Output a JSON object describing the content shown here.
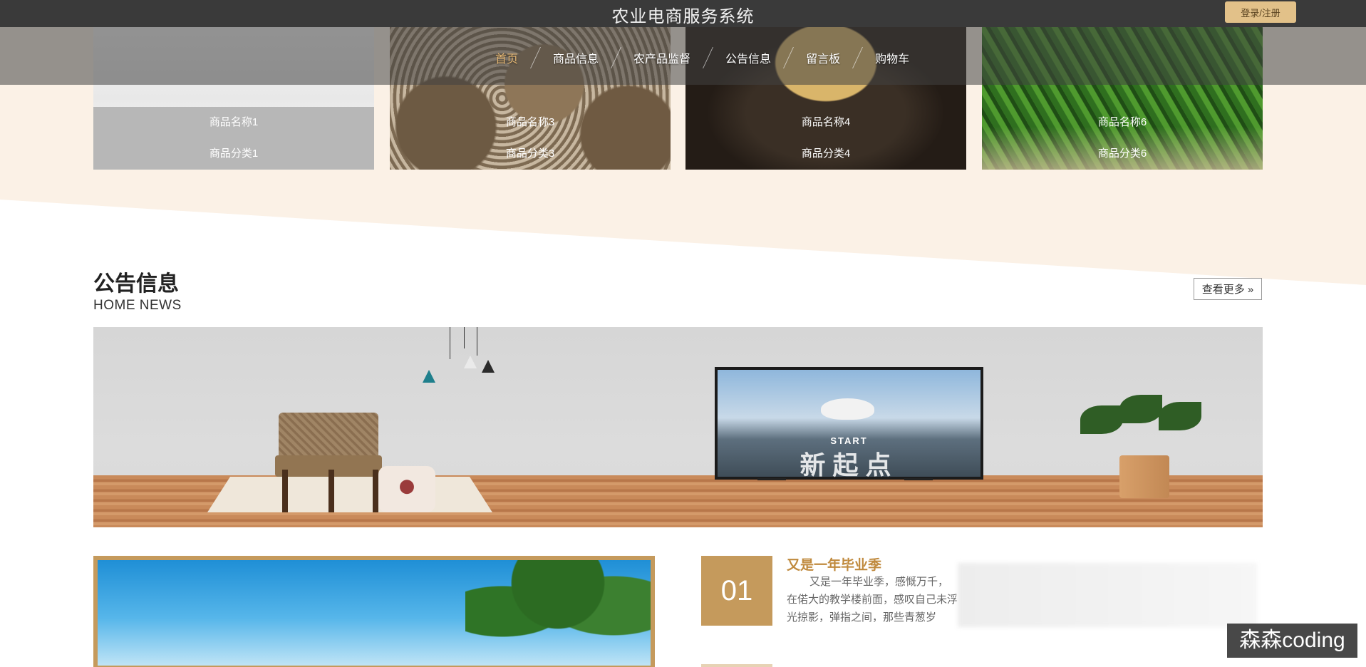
{
  "header": {
    "site_title": "农业电商服务系统",
    "login_label": "登录/注册"
  },
  "nav": {
    "items": [
      {
        "label": "首页",
        "active": true
      },
      {
        "label": "商品信息",
        "active": false
      },
      {
        "label": "农产品监督",
        "active": false
      },
      {
        "label": "公告信息",
        "active": false
      },
      {
        "label": "留言板",
        "active": false
      },
      {
        "label": "购物车",
        "active": false
      }
    ]
  },
  "products": [
    {
      "name": "商品名称1",
      "category": "商品分类1"
    },
    {
      "name": "商品名称3",
      "category": "商品分类3"
    },
    {
      "name": "商品名称4",
      "category": "商品分类4"
    },
    {
      "name": "商品名称6",
      "category": "商品分类6"
    }
  ],
  "news_section": {
    "title": "公告信息",
    "subtitle": "HOME NEWS",
    "more_label": "查看更多 »"
  },
  "banner": {
    "tv_text_small": "START",
    "tv_text_large": "新起点"
  },
  "news": [
    {
      "number": "01",
      "title": "又是一年毕业季",
      "body": "又是一年毕业季，感慨万千，在偌大的教学楼前面，感叹自己未浮光掠影，弹指之间，那些青葱岁"
    }
  ],
  "watermark": "森森coding",
  "colors": {
    "accent": "#c59a5c",
    "nav_active": "#e6b874",
    "topbar": "#3a3a3a",
    "login_button": "#e2c189"
  }
}
